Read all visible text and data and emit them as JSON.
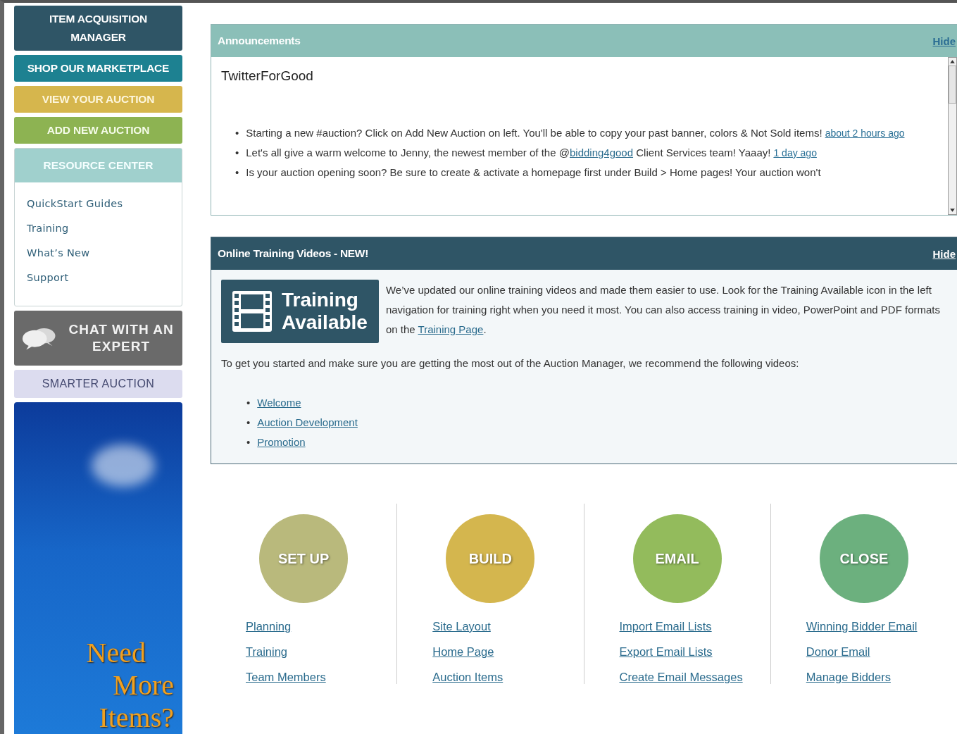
{
  "sidebar": {
    "buttons": [
      {
        "label": "ITEM ACQUISITION MANAGER",
        "kind": "dark"
      },
      {
        "label": "SHOP OUR MARKETPLACE",
        "kind": "teal"
      },
      {
        "label": "VIEW YOUR AUCTION",
        "kind": "gold"
      },
      {
        "label": "ADD NEW AUCTION",
        "kind": "green"
      }
    ],
    "resource_center": {
      "title": "RESOURCE CENTER",
      "links": [
        "QuickStart Guides",
        "Training",
        "What’s New",
        "Support"
      ]
    },
    "chat": {
      "label": "CHAT WITH AN EXPERT"
    },
    "smarter": {
      "label": "SMARTER AUCTION"
    },
    "banner": {
      "lines": [
        "Need",
        "More",
        "Items?"
      ]
    }
  },
  "announcements": {
    "title": "Announcements",
    "hide": "Hide",
    "heading": "TwitterForGood",
    "bullet": "•",
    "items": [
      {
        "parts": [
          {
            "text": "Starting a new #auction? Click on Add New Auction on left. You'll be able to copy your past banner, colors & Not Sold items!"
          }
        ],
        "time": "about 2 hours ago"
      },
      {
        "parts": [
          {
            "text": "Let's all give a warm welcome to Jenny, the newest member of the @"
          },
          {
            "text": "bidding4good",
            "link": true
          },
          {
            "text": " Client Services team! Yaaay!"
          }
        ],
        "time": "1 day ago"
      },
      {
        "parts": [
          {
            "text": "Is your auction opening soon? Be sure to create & activate a homepage first under Build > Home pages! Your auction won't"
          }
        ]
      }
    ]
  },
  "training": {
    "title": "Online Training Videos - NEW!",
    "hide": "Hide",
    "badge": [
      "Training",
      "Available"
    ],
    "intro": [
      {
        "text": "We’ve updated our online training videos and made them easier to use. Look for the Training Available icon in the left navigation for training right when you need it most. You can also access training in video, PowerPoint and PDF formats on the "
      },
      {
        "text": "Training Page",
        "link": true
      },
      {
        "text": "."
      }
    ],
    "recommend": "To get you started and make sure you are getting the most out of the Auction Manager, we recommend the following videos:",
    "bullet": "•",
    "videos": [
      "Welcome",
      "Auction Development",
      "Promotion"
    ]
  },
  "steps": [
    {
      "label": "SET UP",
      "color": "#b9b97c",
      "links": [
        "Planning",
        "Training",
        "Team Members"
      ]
    },
    {
      "label": "BUILD",
      "color": "#d4b64e",
      "links": [
        "Site Layout",
        "Home Page",
        "Auction Items"
      ]
    },
    {
      "label": "EMAIL",
      "color": "#93bb5c",
      "links": [
        "Import Email Lists",
        "Export Email Lists",
        "Create Email Messages"
      ]
    },
    {
      "label": "CLOSE",
      "color": "#6cb07e",
      "links": [
        "Winning Bidder Email",
        "Donor Email",
        "Manage Bidders"
      ]
    }
  ]
}
